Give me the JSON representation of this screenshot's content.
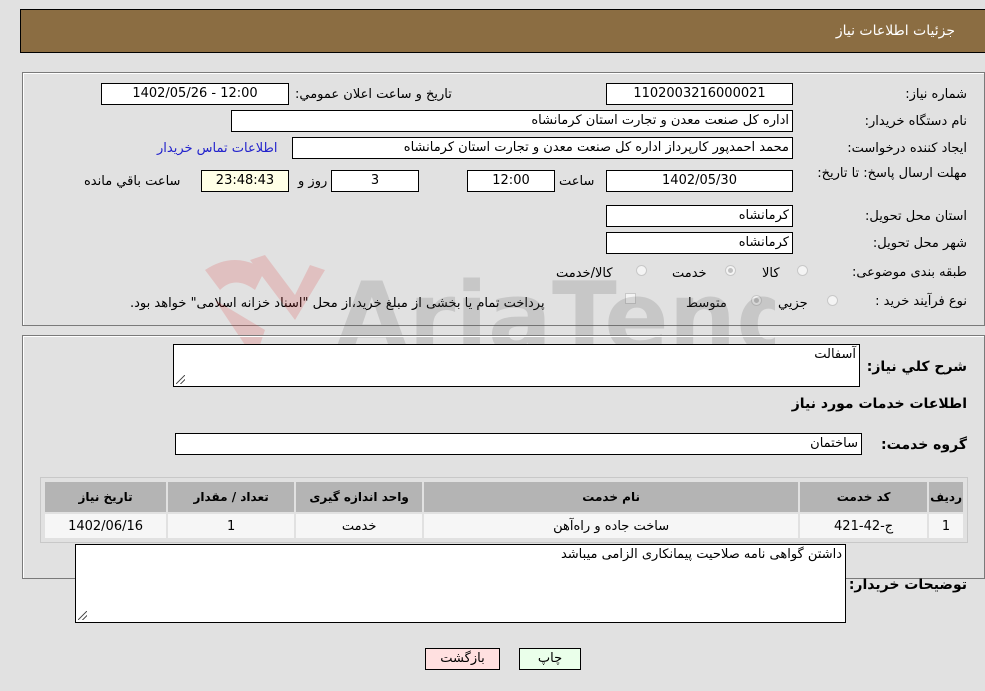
{
  "header": {
    "title": "جزئیات اطلاعات نیاز"
  },
  "form": {
    "need_number_label": "شماره نیاز:",
    "need_number": "1102003216000021",
    "announce_label": "تاریخ و ساعت اعلان عمومي:",
    "announce_value": "1402/05/26 - 12:00",
    "buyer_org_label": "نام دستگاه خریدار:",
    "buyer_org": "اداره کل صنعت  معدن و تجارت استان کرمانشاه",
    "creator_label": "ایجاد کننده درخواست:",
    "creator": "محمد احمدپور کارپرداز اداره کل صنعت  معدن و تجارت استان کرمانشاه",
    "contact_link": "اطلاعات تماس خریدار",
    "deadline_label": "مهلت ارسال پاسخ: تا تاریخ:",
    "deadline_date": "1402/05/30",
    "time_label": "ساعت",
    "deadline_time": "12:00",
    "days": "3",
    "days_label": "روز و",
    "remaining": "23:48:43",
    "remaining_label": "ساعت باقي مانده",
    "province_label": "استان محل تحویل:",
    "province": "کرمانشاه",
    "city_label": "شهر محل تحویل:",
    "city": "کرمانشاه",
    "category_label": "طبقه بندی موضوعی:",
    "category_options": [
      "کالا",
      "خدمت",
      "کالا/خدمت"
    ],
    "category_selected": "خدمت",
    "process_label": "نوع فرآیند خرید :",
    "process_options": [
      "جزيي",
      "متوسط"
    ],
    "process_selected": "متوسط",
    "treasury_note": "پرداخت تمام یا بخشی از مبلغ خرید،از محل \"اسناد خزانه اسلامی\" خواهد بود."
  },
  "details": {
    "summary_label": "شرح کلي نیاز:",
    "summary": "آسفالت",
    "services_heading": "اطلاعات خدمات مورد نیاز",
    "service_group_label": "گروه خدمت:",
    "service_group": "ساختمان",
    "table": {
      "headers": [
        "ردیف",
        "کد خدمت",
        "نام خدمت",
        "واحد اندازه گیری",
        "تعداد / مقدار",
        "تاریخ نیاز"
      ],
      "rows": [
        [
          "1",
          "ج-42-421",
          "ساخت جاده و راه‌آهن",
          "خدمت",
          "1",
          "1402/06/16"
        ]
      ]
    },
    "buyer_notes_label": "توضیحات خریدار:",
    "buyer_notes": "داشتن گواهی نامه صلاحیت پیمانکاری الزامی میباشد"
  },
  "buttons": {
    "print": "چاپ",
    "back": "بازگشت"
  },
  "watermark": "AriaTender.neT",
  "colors": {
    "header_bg": "#8b6d42",
    "print_bg": "#eaffea",
    "back_bg": "#ffe0e0",
    "link": "#2222cc"
  }
}
